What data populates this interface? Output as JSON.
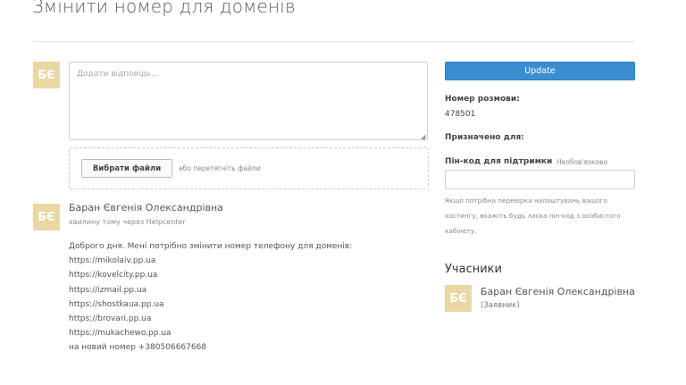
{
  "page": {
    "title": "Змінити номер для доменів"
  },
  "reply": {
    "avatar_initials": "БЄ",
    "placeholder": "Додати відповідь...",
    "choose_files_label": "Вибрати файли",
    "drop_hint": "або перетягніть файли"
  },
  "comment": {
    "avatar_initials": "БЄ",
    "author": "Баран Євгенія Олександрівна",
    "meta": "хвилину тому через Helpcenter",
    "lines": [
      "Доброго дня. Мені потрібно змінити номер телефону для доменів:",
      "https://mikolaiv.pp.ua",
      "https://kovelcity.pp.ua",
      "https://izmail.pp.ua",
      "https://shostkaua.pp.ua",
      "https://brovari.pp.ua",
      "https://mukachewo.pp.ua",
      "на новий номер +380506667668"
    ]
  },
  "sidebar": {
    "update_label": "Update",
    "conversation_number_label": "Номер розмови:",
    "conversation_number_value": "478501",
    "assigned_to_label": "Призначено для:",
    "pin_label": "Пін-код для підтримки",
    "pin_optional": "Необов'язково",
    "pin_help_lines": [
      "Якщо потрібна перевірка налаштувань вашого",
      "хостингу, вкажіть будь ласка пін-код з особистого",
      "кабінету."
    ],
    "participants_heading": "Учасники",
    "participants": [
      {
        "initials": "БЄ",
        "name": "Баран Євгенія Олександрівна",
        "role": "(Заявник)"
      }
    ]
  },
  "colors": {
    "accent": "#3a8dd0",
    "avatar": "#ead7a4"
  }
}
